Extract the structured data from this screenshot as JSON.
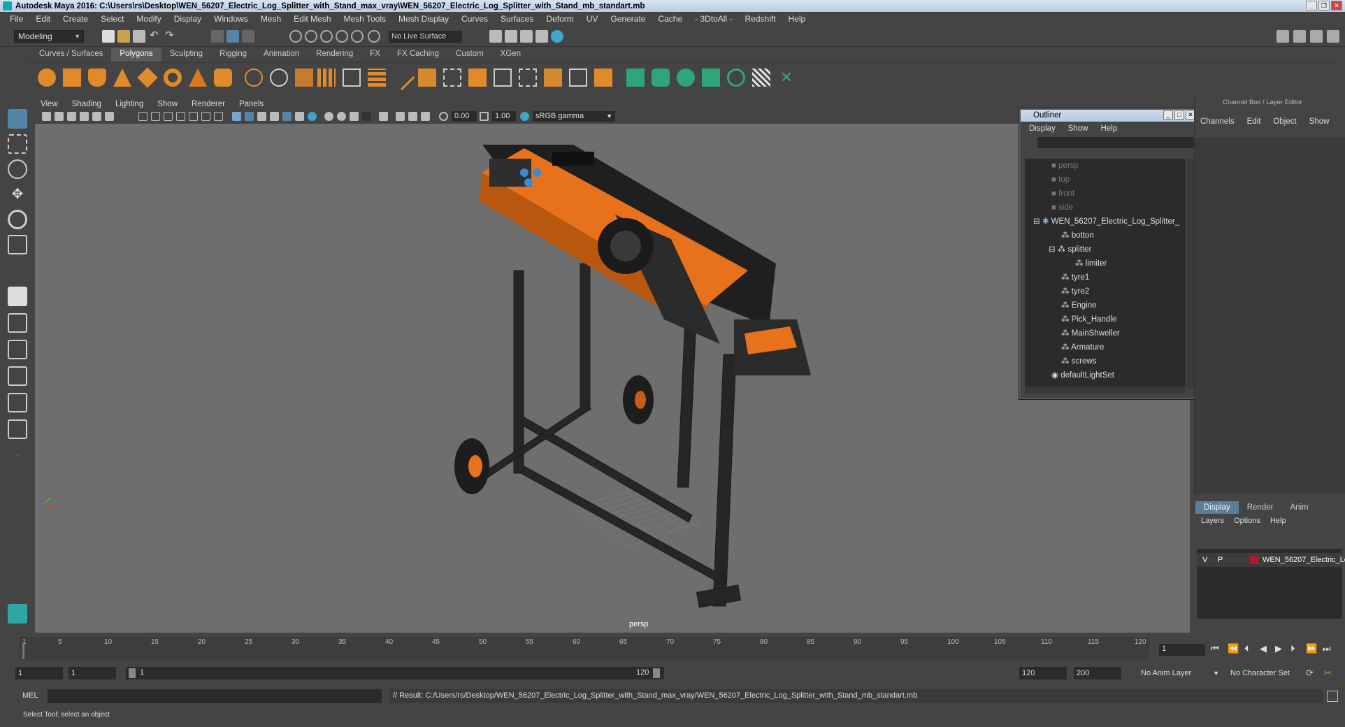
{
  "window": {
    "title": "Autodesk Maya 2016: C:\\Users\\rs\\Desktop\\WEN_56207_Electric_Log_Splitter_with_Stand_max_vray\\WEN_56207_Electric_Log_Splitter_with_Stand_mb_standart.mb"
  },
  "menubar": {
    "items": [
      "File",
      "Edit",
      "Create",
      "Select",
      "Modify",
      "Display",
      "Windows",
      "Mesh",
      "Edit Mesh",
      "Mesh Tools",
      "Mesh Display",
      "Curves",
      "Surfaces",
      "Deform",
      "UV",
      "Generate",
      "Cache",
      "- 3DtoAll -",
      "Redshift",
      "Help"
    ]
  },
  "statusline": {
    "mode": "Modeling",
    "live_surface": "No Live Surface"
  },
  "shelf": {
    "tabs": [
      "Curves / Surfaces",
      "Polygons",
      "Sculpting",
      "Rigging",
      "Animation",
      "Rendering",
      "FX",
      "FX Caching",
      "Custom",
      "XGen"
    ],
    "active_tab": "Polygons"
  },
  "viewport": {
    "menu": [
      "View",
      "Shading",
      "Lighting",
      "Show",
      "Renderer",
      "Panels"
    ],
    "exposure": "0.00",
    "gamma": "1.00",
    "color_space": "sRGB gamma",
    "camera_label": "persp"
  },
  "outliner": {
    "title": "Outliner",
    "menu": [
      "Display",
      "Show",
      "Help"
    ],
    "items": [
      {
        "label": "persp",
        "depth": 0,
        "kind": "camera"
      },
      {
        "label": "top",
        "depth": 0,
        "kind": "camera"
      },
      {
        "label": "front",
        "depth": 0,
        "kind": "camera"
      },
      {
        "label": "side",
        "depth": 0,
        "kind": "camera"
      },
      {
        "label": "WEN_56207_Electric_Log_Splitter_",
        "depth": 0,
        "kind": "group"
      },
      {
        "label": "botton",
        "depth": 1,
        "kind": "mesh"
      },
      {
        "label": "splitter",
        "depth": 1,
        "kind": "mesh"
      },
      {
        "label": "limiter",
        "depth": 2,
        "kind": "mesh"
      },
      {
        "label": "tyre1",
        "depth": 1,
        "kind": "mesh"
      },
      {
        "label": "tyre2",
        "depth": 1,
        "kind": "mesh"
      },
      {
        "label": "Engine",
        "depth": 1,
        "kind": "mesh"
      },
      {
        "label": "Pick_Handle",
        "depth": 1,
        "kind": "mesh"
      },
      {
        "label": "MainShweller",
        "depth": 1,
        "kind": "mesh"
      },
      {
        "label": "Armature",
        "depth": 1,
        "kind": "mesh"
      },
      {
        "label": "screws",
        "depth": 1,
        "kind": "mesh"
      },
      {
        "label": "defaultLightSet",
        "depth": 0,
        "kind": "set"
      }
    ]
  },
  "channelbox": {
    "title": "Channel Box / Layer Editor",
    "menu": [
      "Channels",
      "Edit",
      "Object",
      "Show"
    ]
  },
  "layer_editor": {
    "tabs": [
      "Display",
      "Render",
      "Anim"
    ],
    "active_tab": "Display",
    "menu": [
      "Layers",
      "Options",
      "Help"
    ],
    "layer": {
      "v": "V",
      "p": "P",
      "name": "WEN_56207_Electric_Lo",
      "color": "#b01a2c"
    }
  },
  "timeline": {
    "ticks": [
      "1",
      "5",
      "10",
      "15",
      "20",
      "25",
      "30",
      "35",
      "40",
      "45",
      "50",
      "55",
      "60",
      "65",
      "70",
      "75",
      "80",
      "85",
      "90",
      "95",
      "100",
      "105",
      "110",
      "115",
      "120"
    ],
    "current_frame": "1"
  },
  "range": {
    "start": "1",
    "start2": "1",
    "slider_start": "1",
    "slider_end": "120",
    "end": "120",
    "end2": "200",
    "anim_layer": "No Anim Layer",
    "character_set": "No Character Set"
  },
  "command": {
    "lang": "MEL",
    "result": "// Result: C:/Users/rs/Desktop/WEN_56207_Electric_Log_Splitter_with_Stand_max_vray/WEN_56207_Electric_Log_Splitter_with_Stand_mb_standart.mb"
  },
  "help_line": "Select Tool: select an object",
  "colors": {
    "accent": "#5285a6",
    "shelf_orange": "#e08a2a",
    "shelf_green": "#2fa67a",
    "product_orange": "#e8721c"
  }
}
